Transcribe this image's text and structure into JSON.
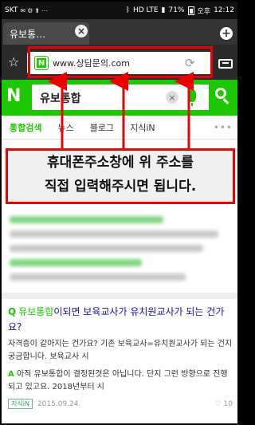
{
  "status_bar": {
    "carrier": "SKT",
    "network": "HD LTE",
    "battery": "71%",
    "ampm": "오후",
    "time": "12:12"
  },
  "browser": {
    "tab_title": "유보통…",
    "tab_close_icon": "×",
    "new_tab_icon": "+",
    "url": "www.상담문의.com"
  },
  "search": {
    "logo": "N",
    "query": "유보통합",
    "clear_icon": "×"
  },
  "categories": [
    "통합검색",
    "뉴스",
    "블로그",
    "지식iN"
  ],
  "instruction": {
    "line1": "휴대폰주소창에 위 주소를",
    "line2": "직접 입력해주시면 됩니다."
  },
  "qa": {
    "q_mark": "Q",
    "q_highlight": "유보통합",
    "question": "이되면 보육교사가 유치원교사가 되는 건가요?",
    "answer_preview": "자격증이 같아지는 건가요? 기존 보육교사=유치원교사가 되는 건지 궁금합니다. 보육교사 시",
    "a_mark": "A",
    "answer": "아직 유보통합이 결정된것은 아닙니다. 단지 그런 방향으로 진행되고 있고요. 2018년부터 시",
    "source": "지식iN",
    "date": "2015.09.24.",
    "likes": "10"
  },
  "colors": {
    "naver_green": "#1ec800",
    "annotation_red": "#e00000"
  }
}
